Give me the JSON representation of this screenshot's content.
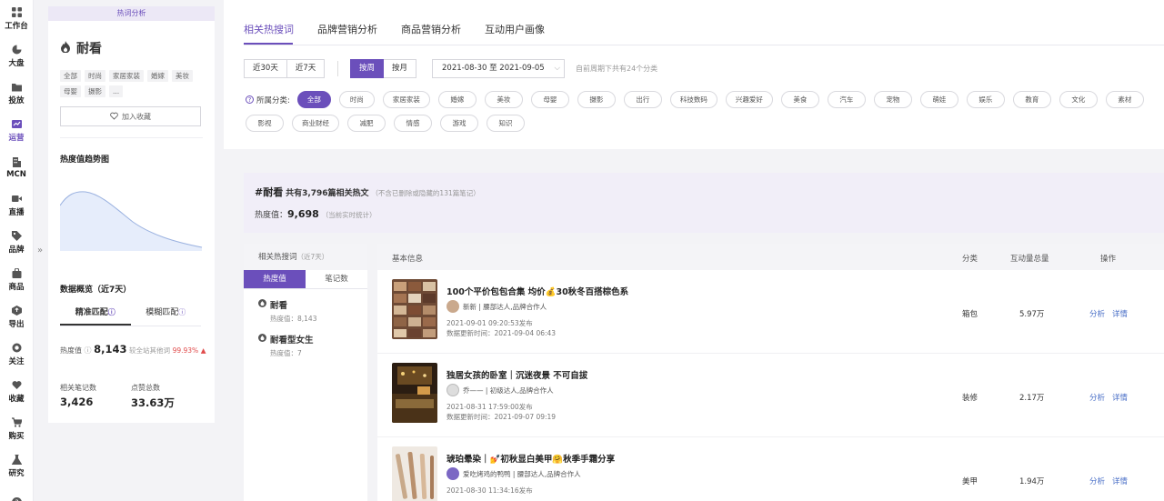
{
  "nav": [
    {
      "label": "工作台",
      "icon": "grid-icon"
    },
    {
      "label": "大盘",
      "icon": "pie-icon"
    },
    {
      "label": "投放",
      "icon": "folder-icon"
    },
    {
      "label": "运营",
      "icon": "chart-icon",
      "active": true
    },
    {
      "label": "MCN",
      "icon": "building-icon"
    },
    {
      "label": "直播",
      "icon": "video-icon"
    },
    {
      "label": "品牌",
      "icon": "tag-icon"
    },
    {
      "label": "商品",
      "icon": "bag-icon"
    },
    {
      "label": "导出",
      "icon": "export-icon"
    },
    {
      "label": "关注",
      "icon": "eye-icon"
    },
    {
      "label": "收藏",
      "icon": "heart-icon"
    },
    {
      "label": "购买",
      "icon": "cart-icon"
    },
    {
      "label": "研究",
      "icon": "flask-icon"
    },
    {
      "label": "",
      "icon": "help-icon"
    }
  ],
  "collapse_glyph": "»",
  "left": {
    "header": "热词分析",
    "keyword": "耐看",
    "tags": [
      "全部",
      "时尚",
      "家居家装",
      "婚嫁",
      "美妆",
      "母婴",
      "摄影",
      "..."
    ],
    "fav_label": "加入收藏",
    "trend_title": "热度值趋势图",
    "overview_title": "数据概览（近7天）",
    "match_tabs": [
      "精准匹配",
      "模糊匹配"
    ],
    "hot_label": "热度值",
    "hot_value": "8,143",
    "hot_compare": "较全站其他词",
    "hot_pct": "99.93%",
    "hot_arrow": "▲",
    "notes_label": "相关笔记数",
    "notes_value": "3,426",
    "likes_label": "点赞总数",
    "likes_value": "33.63万"
  },
  "filters": {
    "tabs": [
      "相关热搜词",
      "品牌营销分析",
      "商品营销分析",
      "互动用户画像"
    ],
    "range_buttons": [
      "近30天",
      "近7天"
    ],
    "period_buttons": [
      "按周",
      "按月"
    ],
    "date_range": "2021-08-30 至 2021-09-05",
    "date_chevron": "⌵",
    "date_hint": "自前周期下共有24个分类",
    "category_label": "所属分类:",
    "categories": [
      "全部",
      "时尚",
      "家居家装",
      "婚嫁",
      "美妆",
      "母婴",
      "摄影",
      "出行",
      "科技数码",
      "兴趣爱好",
      "美食",
      "汽车",
      "宠物",
      "萌娃",
      "娱乐",
      "教育",
      "文化",
      "素材",
      "影视",
      "商业财经",
      "减肥",
      "情感",
      "游戏",
      "知识"
    ]
  },
  "summary": {
    "keyword": "#耐看",
    "count_text": "共有3,796篇相关热文",
    "count_note": "（不含已删除或隐藏的131篇笔记）",
    "heat_label": "热度值：",
    "heat_value": "9,698",
    "heat_note": "（当前实时统计）"
  },
  "related": {
    "title": "相关热搜词",
    "title_note": "（近7天）",
    "tabs": [
      "热度值",
      "笔记数"
    ],
    "items": [
      {
        "name": "耐看",
        "heat": "热度值：8,143"
      },
      {
        "name": "耐看型女生",
        "heat": "热度值：7"
      }
    ]
  },
  "table": {
    "headers": [
      "基本信息",
      "分类",
      "互动量总量",
      "操作"
    ],
    "rows": [
      {
        "title": "100个平价包包合集 均价💰30秋冬百搭棕色系",
        "author": "新新",
        "author_tag": "| 腰部达人,品牌合作人",
        "published": "2021-09-01 09:20:53发布",
        "updated": "数据更新时间：2021-09-04 06:43",
        "category": "箱包",
        "interactions": "5.97万",
        "op_analyze": "分析",
        "op_detail": "详情"
      },
      {
        "title": "独居女孩的卧室｜沉迷夜景 不可自拔",
        "author": "乔——",
        "author_tag": "| 初级达人,品牌合作人",
        "published": "2021-08-31 17:59:00发布",
        "updated": "数据更新时间：2021-09-07 09:19",
        "category": "装修",
        "interactions": "2.17万",
        "op_analyze": "分析",
        "op_detail": "详情"
      },
      {
        "title": "琥珀晕染｜💅初秋显白美甲🤗秋季手霜分享",
        "author": "爱吃烤鸡的鸭鸭",
        "author_tag": "| 腰部达人,品牌合作人",
        "published": "2021-08-30 11:34:16发布",
        "updated": "",
        "category": "美甲",
        "interactions": "1.94万",
        "op_analyze": "分析",
        "op_detail": "详情"
      }
    ]
  },
  "colors": {
    "accent": "#6b4fbb",
    "link": "#4a6fc7",
    "up": "#e04b4b"
  }
}
